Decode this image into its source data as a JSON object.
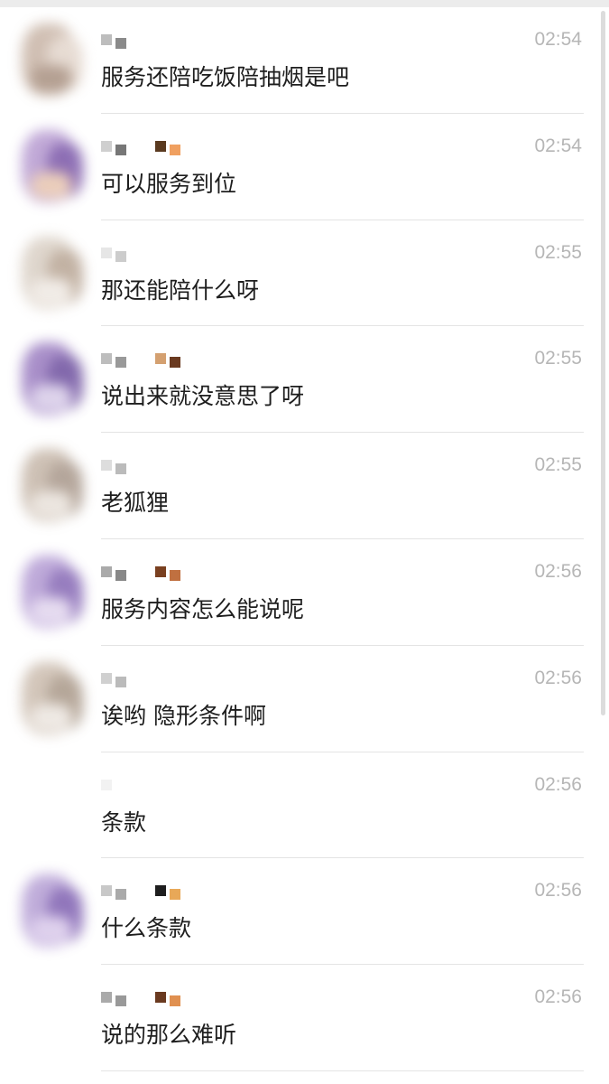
{
  "chats": [
    {
      "time": "02:54",
      "message": "服务还陪吃饭陪抽烟是吧",
      "avatar_colors": [
        "#c8b4a6",
        "#e3d6cc",
        "#a89080"
      ],
      "name_pixels": [
        "#bdbdbd",
        "#8a8a8a"
      ]
    },
    {
      "time": "02:54",
      "message": "可以服务到位",
      "avatar_colors": [
        "#b69ad0",
        "#7a56a8",
        "#e8c6b0"
      ],
      "name_pixels": [
        "#cfcfcf",
        "#777777",
        "#5a3a20",
        "#f0a060"
      ]
    },
    {
      "time": "02:55",
      "message": "那还能陪什么呀",
      "avatar_colors": [
        "#d9cfc4",
        "#b8a594",
        "#efe9e3"
      ],
      "name_pixels": [
        "#e6e6e6",
        "#cccccc"
      ]
    },
    {
      "time": "02:55",
      "message": "说出来就没意思了呀",
      "avatar_colors": [
        "#9a7cc0",
        "#6d4f9e",
        "#d8cce8"
      ],
      "name_pixels": [
        "#bdbdbd",
        "#999999",
        "#d4a070",
        "#6a3a20"
      ]
    },
    {
      "time": "02:55",
      "message": "老狐狸",
      "avatar_colors": [
        "#c5b6a8",
        "#a8978a",
        "#e9e2db"
      ],
      "name_pixels": [
        "#dddddd",
        "#bbbbbb"
      ]
    },
    {
      "time": "02:56",
      "message": "服务内容怎么能说呢",
      "avatar_colors": [
        "#b39bd3",
        "#8567b4",
        "#e2d6ee"
      ],
      "name_pixels": [
        "#aaaaaa",
        "#888888",
        "#7a4020",
        "#c07040"
      ]
    },
    {
      "time": "02:56",
      "message": "诶哟 隐形条件啊",
      "avatar_colors": [
        "#cbbcae",
        "#a99888",
        "#ece6e0"
      ],
      "name_pixels": [
        "#d0d0d0",
        "#bbbbbb"
      ]
    },
    {
      "time": "02:56",
      "message": "条款",
      "avatar_colors": [
        "#ffffff",
        "#ffffff",
        "#ffffff"
      ],
      "name_pixels": [
        "#f2f2f2"
      ]
    },
    {
      "time": "02:56",
      "message": "什么条款",
      "avatar_colors": [
        "#b59fd4",
        "#7e5fb0",
        "#d9c9ea"
      ],
      "name_pixels": [
        "#c8c8c8",
        "#aaaaaa",
        "#1e1e1e",
        "#e8a858"
      ]
    },
    {
      "time": "02:56",
      "message": "说的那么难听",
      "avatar_colors": [
        "#ffffff",
        "#ffffff",
        "#ffffff"
      ],
      "name_pixels": [
        "#aaaaaa",
        "#999999",
        "#6a3a20",
        "#e09050"
      ]
    }
  ]
}
